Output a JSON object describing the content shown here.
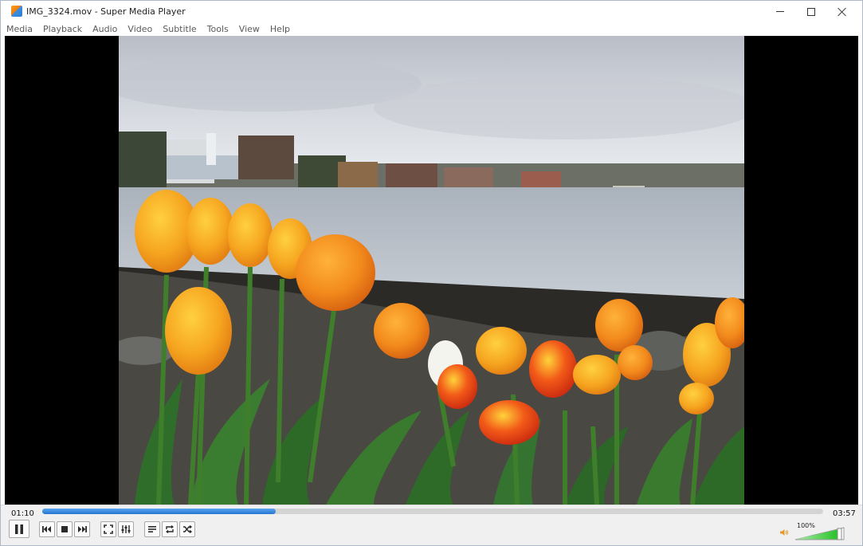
{
  "window": {
    "title": "IMG_3324.mov - Super Media Player"
  },
  "menu": {
    "items": [
      "Media",
      "Playback",
      "Audio",
      "Video",
      "Subtitle",
      "Tools",
      "View",
      "Help"
    ]
  },
  "video": {
    "description_icon": "video-frame-tulips"
  },
  "playback": {
    "elapsed": "01:10",
    "total": "03:57",
    "progress": 0.299
  },
  "controls": {
    "buttons": [
      "pause-icon",
      "previous-icon",
      "stop-icon",
      "next-icon",
      "fullscreen-icon",
      "extended-settings-icon",
      "playlist-icon",
      "loop-icon",
      "shuffle-icon"
    ]
  },
  "volume": {
    "label": "100%",
    "level": 1.0,
    "color": "#26c226"
  },
  "colors": {
    "seek_fill": "#2f86df",
    "video_bg": "#000000"
  }
}
